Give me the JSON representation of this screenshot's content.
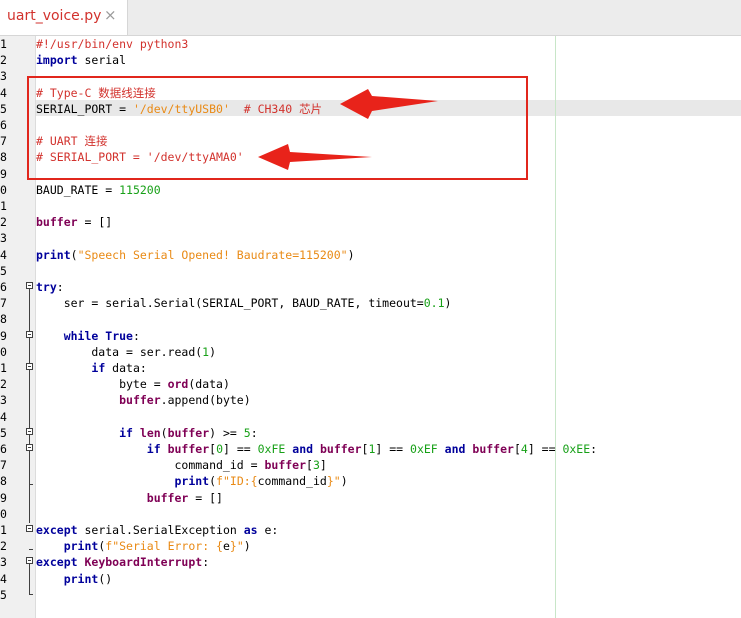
{
  "tab": {
    "title": "uart_voice.py",
    "close_glyph": "×"
  },
  "highlight_color": "#e1261c",
  "lines": [
    {
      "n": "1",
      "tokens": [
        {
          "t": "#!/usr/bin/env python3",
          "c": "cm"
        }
      ]
    },
    {
      "n": "2",
      "tokens": [
        {
          "t": "import",
          "c": "kw"
        },
        {
          "t": " serial"
        }
      ]
    },
    {
      "n": "3",
      "tokens": []
    },
    {
      "n": "4",
      "tokens": [
        {
          "t": "# Type-C 数据线连接",
          "c": "cm"
        }
      ]
    },
    {
      "n": "5",
      "tokens": [
        {
          "t": "SERIAL_PORT = "
        },
        {
          "t": "'/dev/ttyUSB0'",
          "c": "st"
        },
        {
          "t": "  "
        },
        {
          "t": "# CH340 芯片",
          "c": "cm"
        }
      ]
    },
    {
      "n": "6",
      "tokens": []
    },
    {
      "n": "7",
      "tokens": [
        {
          "t": "# UART 连接",
          "c": "cm"
        }
      ]
    },
    {
      "n": "8",
      "tokens": [
        {
          "t": "# SERIAL_PORT = '/dev/ttyAMA0'",
          "c": "cm"
        }
      ]
    },
    {
      "n": "9",
      "tokens": []
    },
    {
      "n": "0",
      "tokens": [
        {
          "t": "BAUD_RATE = "
        },
        {
          "t": "115200",
          "c": "nm"
        }
      ]
    },
    {
      "n": "1",
      "tokens": []
    },
    {
      "n": "2",
      "tokens": [
        {
          "t": "buffer",
          "c": "bi"
        },
        {
          "t": " = []"
        }
      ]
    },
    {
      "n": "3",
      "tokens": []
    },
    {
      "n": "4",
      "tokens": [
        {
          "t": "print",
          "c": "kw"
        },
        {
          "t": "("
        },
        {
          "t": "\"Speech Serial Opened! Baudrate=115200\"",
          "c": "st"
        },
        {
          "t": ")"
        }
      ]
    },
    {
      "n": "5",
      "tokens": []
    },
    {
      "n": "6",
      "tokens": [
        {
          "t": "try",
          "c": "kw"
        },
        {
          "t": ":"
        }
      ]
    },
    {
      "n": "7",
      "tokens": [
        {
          "t": "    ser = serial.Serial(SERIAL_PORT, BAUD_RATE, timeout="
        },
        {
          "t": "0.1",
          "c": "nm"
        },
        {
          "t": ")"
        }
      ]
    },
    {
      "n": "8",
      "tokens": []
    },
    {
      "n": "9",
      "tokens": [
        {
          "t": "    "
        },
        {
          "t": "while",
          "c": "kw"
        },
        {
          "t": " "
        },
        {
          "t": "True",
          "c": "kw"
        },
        {
          "t": ":"
        }
      ]
    },
    {
      "n": "0",
      "tokens": [
        {
          "t": "        data = ser.read("
        },
        {
          "t": "1",
          "c": "nm"
        },
        {
          "t": ")"
        }
      ]
    },
    {
      "n": "1",
      "tokens": [
        {
          "t": "        "
        },
        {
          "t": "if",
          "c": "kw"
        },
        {
          "t": " data:"
        }
      ]
    },
    {
      "n": "2",
      "tokens": [
        {
          "t": "            byte = "
        },
        {
          "t": "ord",
          "c": "bi"
        },
        {
          "t": "(data)"
        }
      ]
    },
    {
      "n": "3",
      "tokens": [
        {
          "t": "            "
        },
        {
          "t": "buffer",
          "c": "bi"
        },
        {
          "t": ".append(byte)"
        }
      ]
    },
    {
      "n": "4",
      "tokens": []
    },
    {
      "n": "5",
      "tokens": [
        {
          "t": "            "
        },
        {
          "t": "if",
          "c": "kw"
        },
        {
          "t": " "
        },
        {
          "t": "len",
          "c": "bi"
        },
        {
          "t": "("
        },
        {
          "t": "buffer",
          "c": "bi"
        },
        {
          "t": ") >= "
        },
        {
          "t": "5",
          "c": "nm"
        },
        {
          "t": ":"
        }
      ]
    },
    {
      "n": "6",
      "tokens": [
        {
          "t": "                "
        },
        {
          "t": "if",
          "c": "kw"
        },
        {
          "t": " "
        },
        {
          "t": "buffer",
          "c": "bi"
        },
        {
          "t": "["
        },
        {
          "t": "0",
          "c": "nm"
        },
        {
          "t": "] == "
        },
        {
          "t": "0xFE",
          "c": "nm"
        },
        {
          "t": " "
        },
        {
          "t": "and",
          "c": "kw"
        },
        {
          "t": " "
        },
        {
          "t": "buffer",
          "c": "bi"
        },
        {
          "t": "["
        },
        {
          "t": "1",
          "c": "nm"
        },
        {
          "t": "] == "
        },
        {
          "t": "0xEF",
          "c": "nm"
        },
        {
          "t": " "
        },
        {
          "t": "and",
          "c": "kw"
        },
        {
          "t": " "
        },
        {
          "t": "buffer",
          "c": "bi"
        },
        {
          "t": "["
        },
        {
          "t": "4",
          "c": "nm"
        },
        {
          "t": "] == "
        },
        {
          "t": "0xEE",
          "c": "nm"
        },
        {
          "t": ":"
        }
      ]
    },
    {
      "n": "7",
      "tokens": [
        {
          "t": "                    command_id = "
        },
        {
          "t": "buffer",
          "c": "bi"
        },
        {
          "t": "["
        },
        {
          "t": "3",
          "c": "nm"
        },
        {
          "t": "]"
        }
      ]
    },
    {
      "n": "8",
      "tokens": [
        {
          "t": "                    "
        },
        {
          "t": "print",
          "c": "kw"
        },
        {
          "t": "("
        },
        {
          "t": "f\"ID:{",
          "c": "st"
        },
        {
          "t": "command_id"
        },
        {
          "t": "}\"",
          "c": "st"
        },
        {
          "t": ")"
        }
      ]
    },
    {
      "n": "9",
      "tokens": [
        {
          "t": "                "
        },
        {
          "t": "buffer",
          "c": "bi"
        },
        {
          "t": " = []"
        }
      ]
    },
    {
      "n": "0",
      "tokens": []
    },
    {
      "n": "1",
      "tokens": [
        {
          "t": "except",
          "c": "kw"
        },
        {
          "t": " serial.SerialException "
        },
        {
          "t": "as",
          "c": "kw"
        },
        {
          "t": " e:"
        }
      ]
    },
    {
      "n": "2",
      "tokens": [
        {
          "t": "    "
        },
        {
          "t": "print",
          "c": "kw"
        },
        {
          "t": "("
        },
        {
          "t": "f\"Serial Error: {",
          "c": "st"
        },
        {
          "t": "e"
        },
        {
          "t": "}\"",
          "c": "st"
        },
        {
          "t": ")"
        }
      ]
    },
    {
      "n": "3",
      "tokens": [
        {
          "t": "except",
          "c": "kw"
        },
        {
          "t": " "
        },
        {
          "t": "KeyboardInterrupt",
          "c": "bi"
        },
        {
          "t": ":"
        }
      ]
    },
    {
      "n": "4",
      "tokens": [
        {
          "t": "    "
        },
        {
          "t": "print",
          "c": "kw"
        },
        {
          "t": "()"
        }
      ]
    },
    {
      "n": "5",
      "tokens": []
    }
  ]
}
